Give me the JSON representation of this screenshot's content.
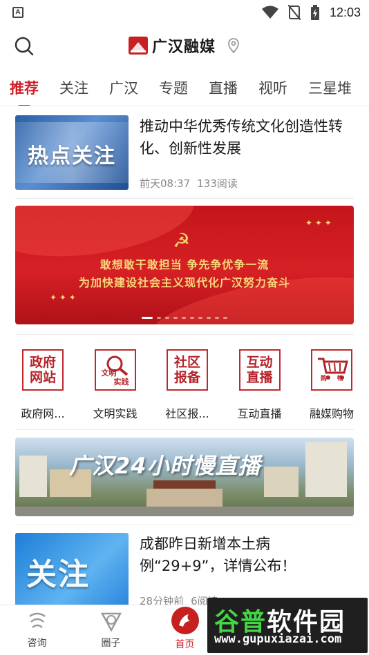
{
  "status_bar": {
    "left_badge": "A",
    "time": "12:03"
  },
  "header": {
    "brand_title": "广汉融媒",
    "search_icon": "search-icon",
    "location_icon": "location-pin-icon"
  },
  "tabs": [
    {
      "label": "推荐",
      "active": true
    },
    {
      "label": "关注",
      "active": false
    },
    {
      "label": "广汉",
      "active": false
    },
    {
      "label": "专题",
      "active": false
    },
    {
      "label": "直播",
      "active": false
    },
    {
      "label": "视听",
      "active": false
    },
    {
      "label": "三星堆",
      "active": false
    }
  ],
  "article_1": {
    "thumb_text": "热点关注",
    "title": "推动中华优秀传统文化创造性转化、创新性发展",
    "time": "前天08:37",
    "reads": "133阅读"
  },
  "banner": {
    "line1": "敢想敢干敢担当  争先争优争一流",
    "line2": "为加快建设社会主义现代化广汉努力奋斗",
    "slide_count": 10,
    "active_slide": 1
  },
  "quick_entries": [
    {
      "icon_text": [
        "政府",
        "网站"
      ],
      "label": "政府网...",
      "icon": "gov-site-icon"
    },
    {
      "icon_text": [
        "文明",
        "实践"
      ],
      "label": "文明实践",
      "icon": "civilization-practice-icon"
    },
    {
      "icon_text": [
        "社区",
        "报备"
      ],
      "label": "社区报...",
      "icon": "community-report-icon"
    },
    {
      "icon_text": [
        "互动",
        "直播"
      ],
      "label": "互动直播",
      "icon": "interactive-live-icon"
    },
    {
      "icon_text": [
        "购",
        "物"
      ],
      "label": "融媒购物",
      "icon": "shopping-cart-icon"
    }
  ],
  "live_banner": {
    "title": "广汉24小时慢直播"
  },
  "article_2": {
    "thumb_text": "关注",
    "title": "成都昨日新增本土病例“29+9”，详情公布！",
    "time": "28分钟前",
    "reads": "6阅读"
  },
  "bottom_nav": [
    {
      "label": "咨询",
      "icon": "news-icon",
      "active": false
    },
    {
      "label": "圈子",
      "icon": "circle-icon",
      "active": false
    },
    {
      "label": "首页",
      "icon": "home-icon",
      "active": true
    }
  ],
  "watermark": {
    "title_part1": "谷普",
    "title_part2": "软件园",
    "url": "www.gupuxiazai.com"
  },
  "colors": {
    "accent": "#d0202a",
    "banner_red": "#c4161c",
    "banner_gold": "#f7d879"
  }
}
